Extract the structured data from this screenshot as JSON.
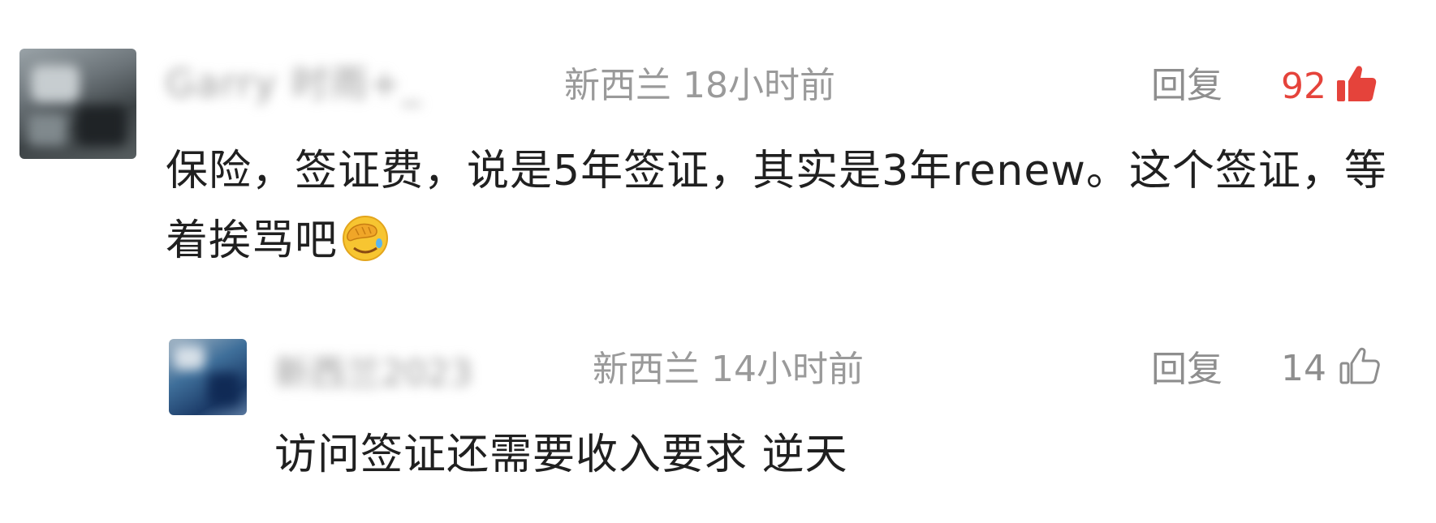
{
  "comments": [
    {
      "username": "Garry 时雨+_",
      "location": "新西兰",
      "time": "18小时前",
      "reply_label": "回复",
      "like_count": "92",
      "liked": true,
      "text": "保险，签证费，说是5年签证，其实是3年renew。这个签证，等着挨骂吧",
      "emoji": "facepalm-crying-emoji"
    },
    {
      "username": "新西兰2023",
      "location": "新西兰",
      "time": "14小时前",
      "reply_label": "回复",
      "like_count": "14",
      "liked": false,
      "text": "访问签证还需要收入要求 逆天"
    }
  ],
  "colors": {
    "liked_accent": "#e5433b",
    "meta_gray": "#9a9a9a",
    "text": "#202020"
  }
}
